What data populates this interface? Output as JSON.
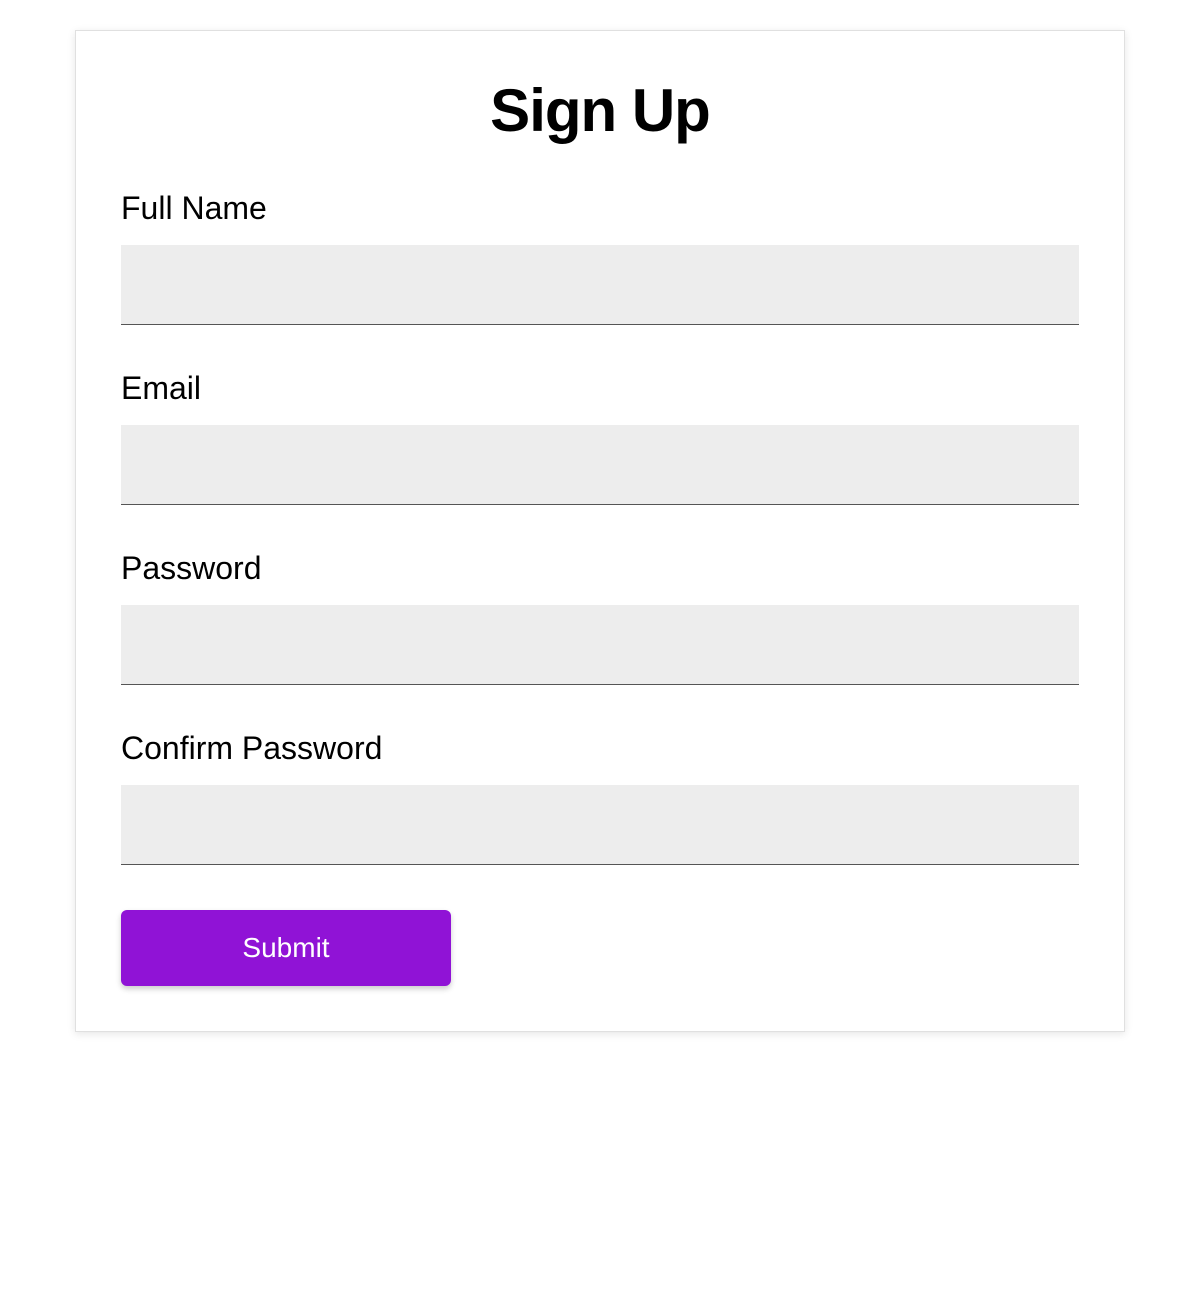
{
  "form": {
    "title": "Sign Up",
    "fields": {
      "fullname": {
        "label": "Full Name",
        "value": ""
      },
      "email": {
        "label": "Email",
        "value": ""
      },
      "password": {
        "label": "Password",
        "value": ""
      },
      "confirm_password": {
        "label": "Confirm Password",
        "value": ""
      }
    },
    "submit_label": "Submit"
  },
  "colors": {
    "accent": "#9013d6",
    "input_bg": "#ededed"
  }
}
